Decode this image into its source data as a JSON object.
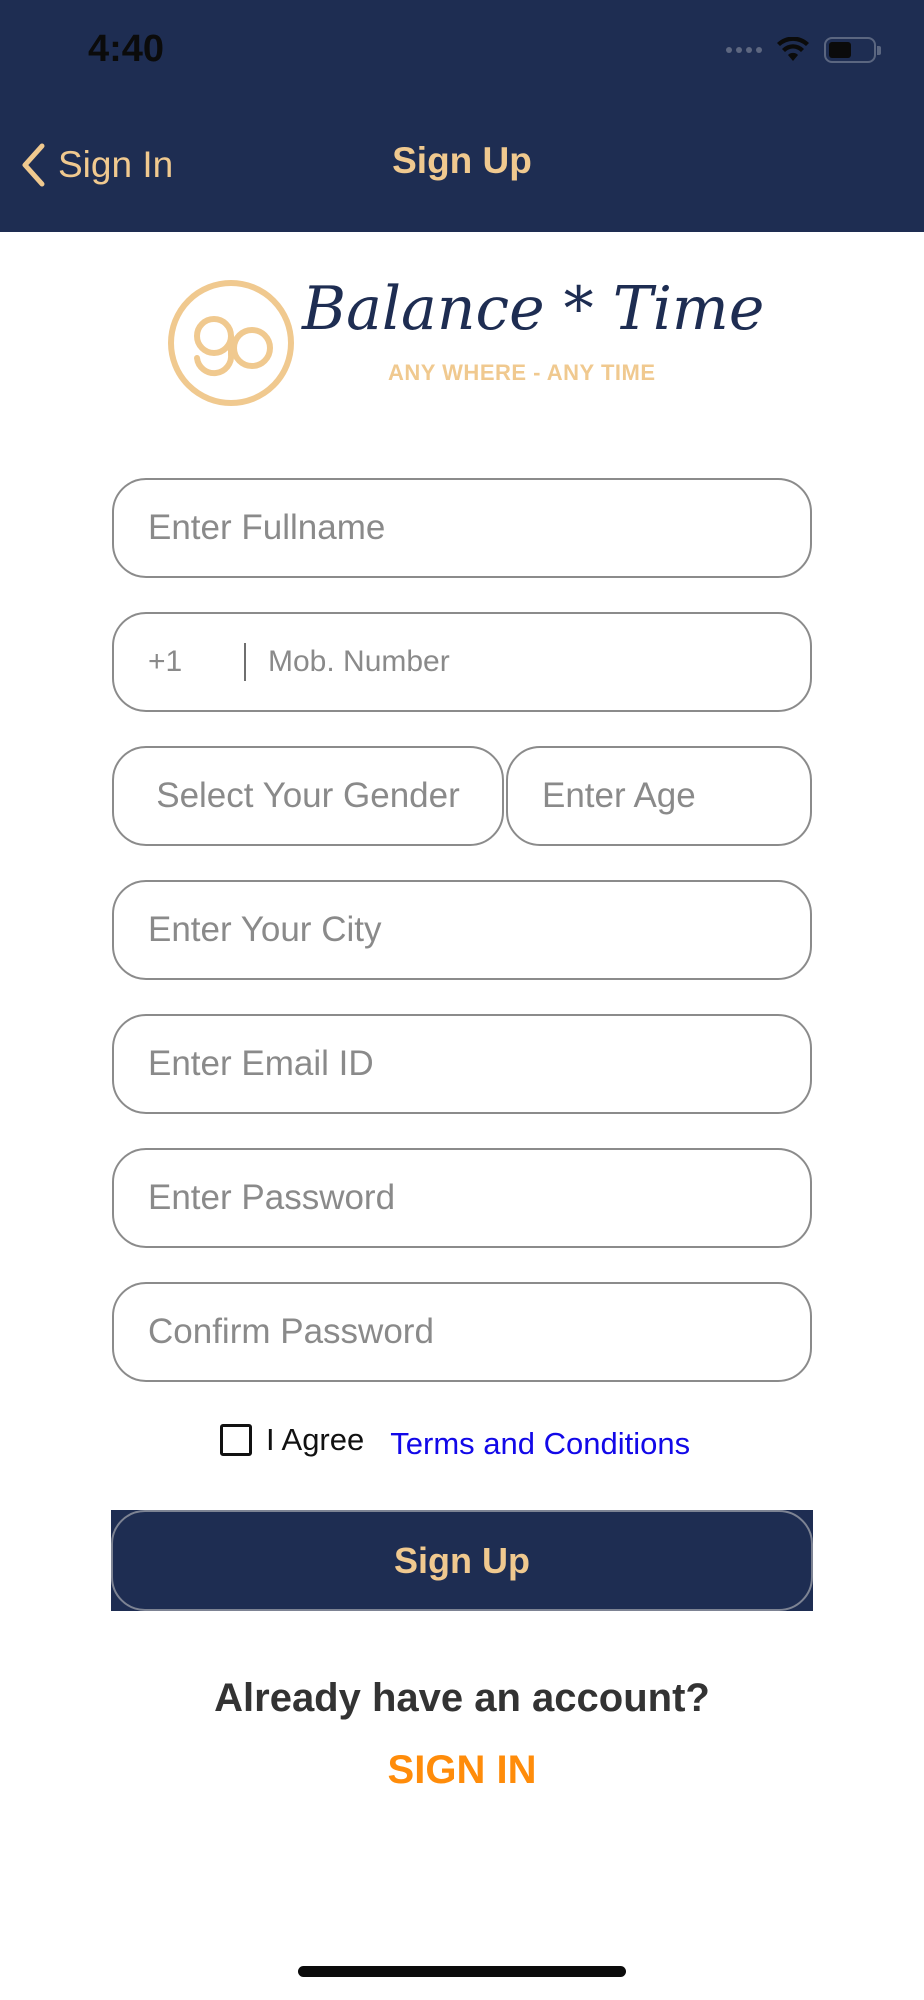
{
  "status_bar": {
    "time": "4:40",
    "icons": [
      "signal-dots-icon",
      "wifi-icon",
      "battery-icon"
    ]
  },
  "nav": {
    "back_label": "Sign In",
    "title": "Sign Up"
  },
  "logo": {
    "title": "Balance * Time",
    "tagline": "ANY WHERE  -  ANY TIME"
  },
  "form": {
    "fullname_placeholder": "Enter Fullname",
    "phone_code": "+1",
    "mobile_placeholder": "Mob. Number",
    "gender_placeholder": "Select Your Gender",
    "age_placeholder": "Enter Age",
    "city_placeholder": "Enter Your City",
    "email_placeholder": "Enter Email ID",
    "password_placeholder": "Enter Password",
    "confirm_password_placeholder": "Confirm Password"
  },
  "terms": {
    "agree_label": "I Agree",
    "link_label": "Terms and Conditions",
    "checked": false
  },
  "signup_button": "Sign Up",
  "footer": {
    "question": "Already have an account?",
    "signin_label": "SIGN IN"
  },
  "colors": {
    "navy": "#1e2d52",
    "gold": "#f0c98f",
    "link_blue": "#1208e8",
    "signin_orange": "#ff8c0a"
  }
}
